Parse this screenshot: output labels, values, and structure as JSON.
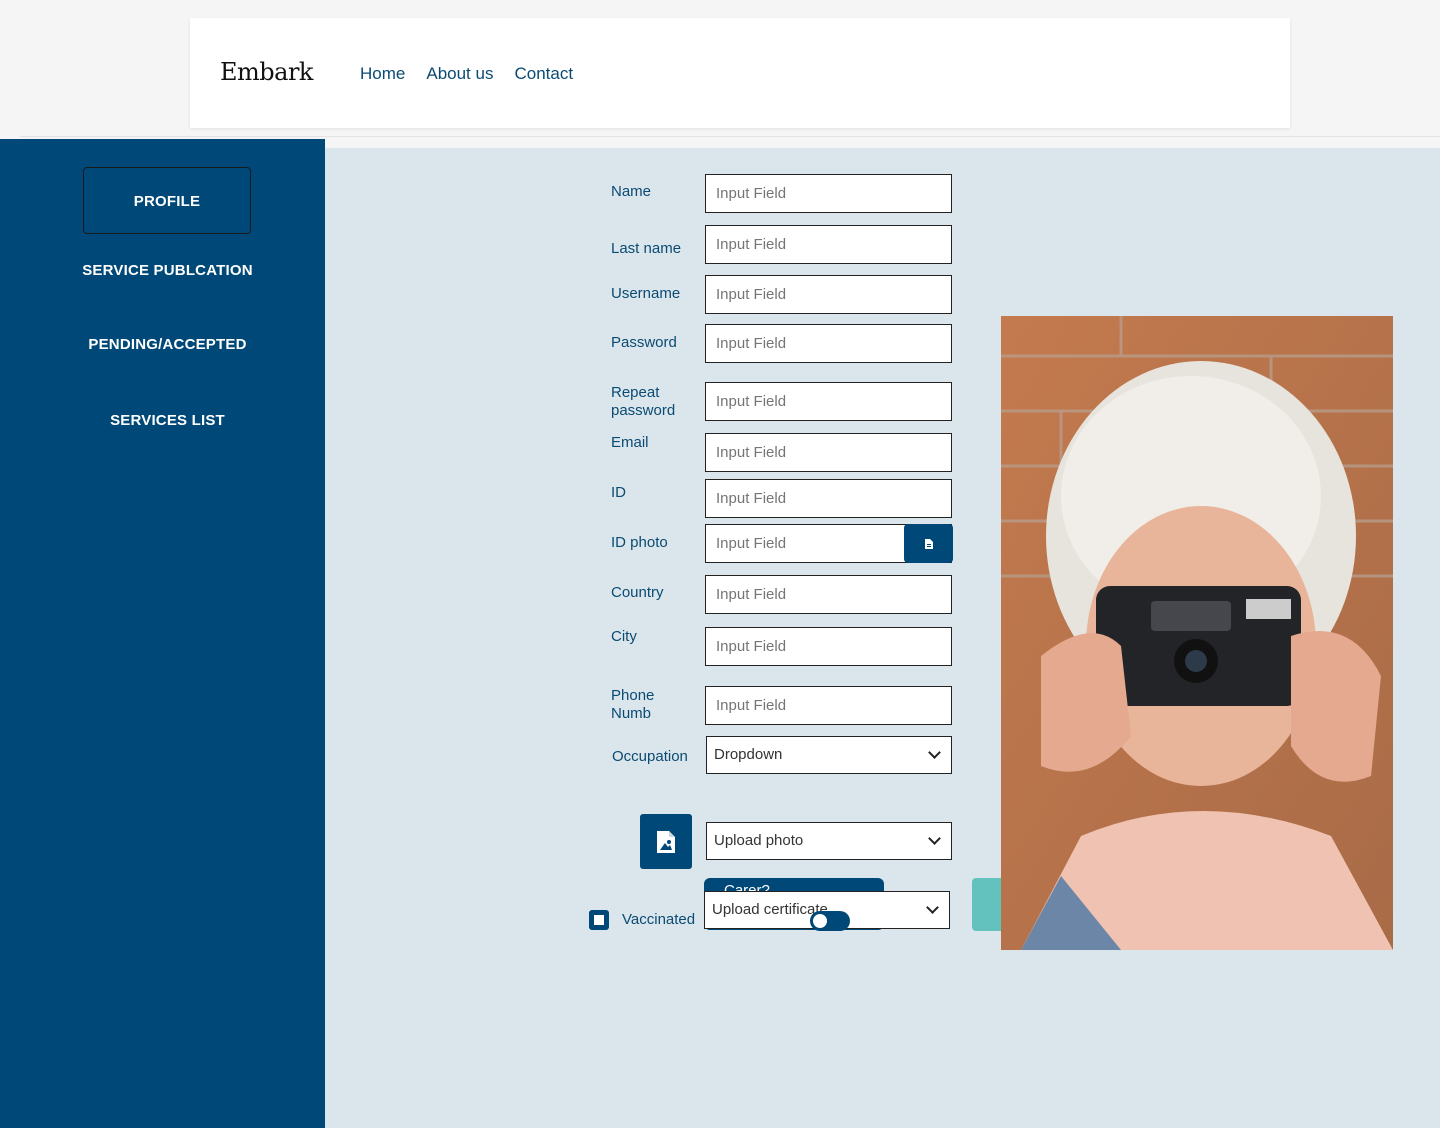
{
  "brand": "Embark",
  "nav": [
    "Home",
    "About us",
    "Contact"
  ],
  "sidebar": {
    "items": [
      "PROFILE",
      "SERVICE PUBLCATION",
      "PENDING/ACCEPTED",
      "SERVICES LIST"
    ]
  },
  "form": {
    "labels": {
      "name": "Name",
      "last_name": "Last name",
      "username": "Username",
      "password": "Password",
      "repeat_password_1": "Repeat",
      "repeat_password_2": "password",
      "email": "Email",
      "id": "ID",
      "id_photo": "ID photo",
      "country": "Country",
      "city": "City",
      "phone_1": "Phone",
      "phone_2": "Numb",
      "occupation": "Occupation",
      "vaccinated": "Vaccinated"
    },
    "placeholder": "Input Field",
    "occupation_value": "Dropdown",
    "upload_photo": "Upload photo",
    "upload_certificate": "Upload certificate",
    "carer": "Carer?"
  },
  "colors": {
    "primary": "#004877",
    "content_bg": "#dbe6ec",
    "accent": "#63c2bd"
  }
}
